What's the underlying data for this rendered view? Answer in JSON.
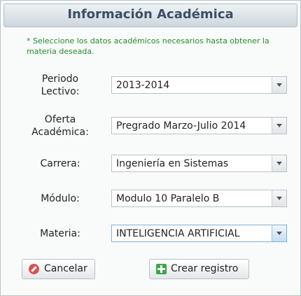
{
  "window": {
    "title": "Información Académica"
  },
  "note": "* Seleccione los datos académicos necesarios hasta obtener la materia deseada.",
  "fields": {
    "periodo": {
      "label_line1": "Periodo",
      "label_line2": "Lectivo:",
      "value": "2013-2014"
    },
    "oferta": {
      "label_line1": "Oferta",
      "label_line2": "Académica:",
      "value": "Pregrado Marzo-Julio 2014"
    },
    "carrera": {
      "label": "Carrera:",
      "value": "Ingeniería en Sistemas"
    },
    "modulo": {
      "label": "Módulo:",
      "value": "Modulo 10 Paralelo B"
    },
    "materia": {
      "label": "Materia:",
      "value": "INTELIGENCIA ARTIFICIAL"
    }
  },
  "buttons": {
    "cancel": "Cancelar",
    "create": "Crear registro"
  },
  "icons": {
    "cancel": "cancel-icon",
    "create": "plus-icon",
    "dropdown": "chevron-down-icon"
  }
}
